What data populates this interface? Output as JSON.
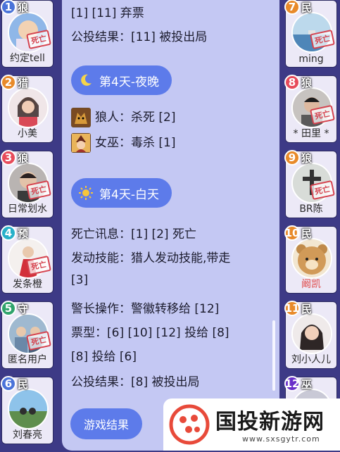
{
  "left_seats": [
    {
      "number": "1",
      "role": "狼",
      "nickname": "约定tell",
      "dead_stamp": "死亡",
      "avatar_icon": "cartoon-avatar-icon"
    },
    {
      "number": "2",
      "role": "猎",
      "nickname": "小美",
      "dead_stamp": "",
      "avatar_icon": "girl-avatar-icon"
    },
    {
      "number": "3",
      "role": "狼",
      "nickname": "日常划水",
      "dead_stamp": "死亡",
      "avatar_icon": "man-avatar-icon"
    },
    {
      "number": "4",
      "role": "预",
      "nickname": "发条橙",
      "dead_stamp": "死亡",
      "avatar_icon": "red-figure-avatar-icon"
    },
    {
      "number": "5",
      "role": "守",
      "nickname": "匿名用户",
      "dead_stamp": "死亡",
      "avatar_icon": "group-avatar-icon"
    },
    {
      "number": "6",
      "role": "民",
      "nickname": "刘春亮",
      "dead_stamp": "",
      "avatar_icon": "landscape-avatar-icon"
    }
  ],
  "right_seats": [
    {
      "number": "7",
      "role": "民",
      "nickname": "ming",
      "dead_stamp": "死亡",
      "avatar_icon": "sea-avatar-icon"
    },
    {
      "number": "8",
      "role": "狼",
      "nickname": "* 田里 *",
      "dead_stamp": "死亡",
      "avatar_icon": "man-avatar-icon"
    },
    {
      "number": "9",
      "role": "狼",
      "nickname": "BR陈",
      "dead_stamp": "死亡",
      "avatar_icon": "cross-avatar-icon"
    },
    {
      "number": "10",
      "role": "民",
      "nickname": "阚凯",
      "dead_stamp": "",
      "avatar_icon": "bear-avatar-icon"
    },
    {
      "number": "11",
      "role": "民",
      "nickname": "刘小人儿",
      "dead_stamp": "",
      "avatar_icon": "girl-avatar-icon"
    },
    {
      "number": "12",
      "role": "巫",
      "nickname": "",
      "dead_stamp": "",
      "avatar_icon": "partial-avatar-icon"
    }
  ],
  "log": {
    "top_line": "[1] [11] 弃票",
    "vote_result_1": "公投结果：[11] 被投出局",
    "night_header": "第4天-夜晚",
    "wolf_action": "狼人：杀死 [2]",
    "witch_action": "女巫：毒杀 [1]",
    "day_header": "第4天-白天",
    "death_info": "死亡讯息：[1] [2] 死亡",
    "skill_line1": "发动技能：猎人发动技能,带走",
    "skill_line2": "[3]",
    "sheriff_action": "警长操作：警徽转移给 [12]",
    "vote_type_line1": "票型：[6] [10] [12] 投给 [8]",
    "vote_type_line2": "[8] 投给 [6]",
    "vote_result_2": "公投结果：[8] 被投出局"
  },
  "game_result_button": "游戏结果",
  "watermark": {
    "title": "国投新游网",
    "url": "www.sxsgytr.com"
  },
  "colors": {
    "background": "#3d3a86",
    "panel": "#c4c8f3",
    "accent": "#5d7bea",
    "dead_red": "#d5434f"
  }
}
